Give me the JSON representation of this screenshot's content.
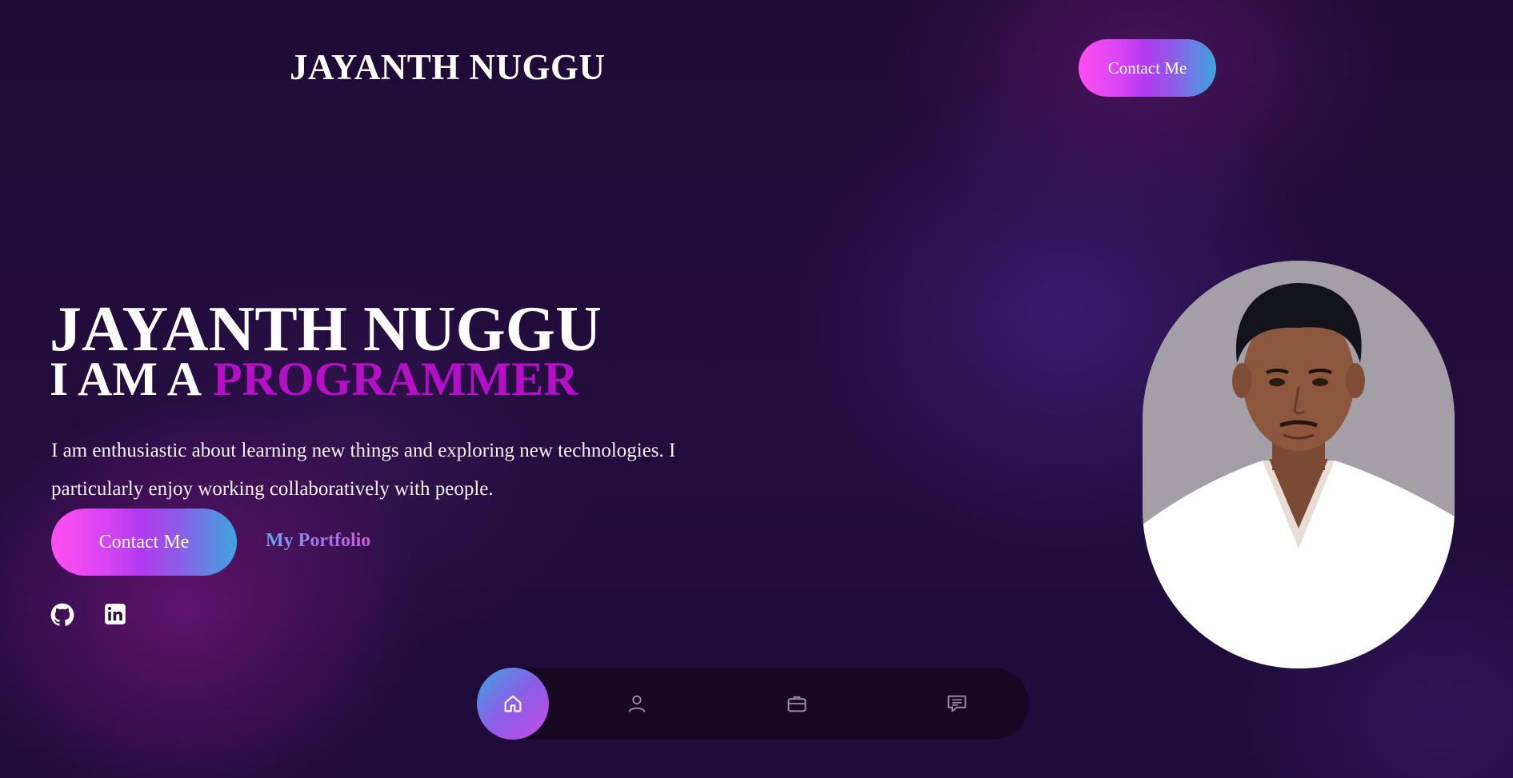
{
  "header": {
    "brand": "JAYANTH NUGGU",
    "contact_label": "Contact Me"
  },
  "hero": {
    "name": "JAYANTH NUGGU",
    "role_prefix": "I AM A",
    "role_highlight": "PROGRAMMER",
    "description": "I am enthusiastic about learning new things and exploring new technologies. I particularly enjoy working collaboratively with people.",
    "contact_label": "Contact Me",
    "portfolio_label": "My Portfolio"
  },
  "social": [
    {
      "icon": "github-icon"
    },
    {
      "icon": "linkedin-icon"
    }
  ],
  "bottom_nav": {
    "items": [
      {
        "icon": "home-icon",
        "active": true
      },
      {
        "icon": "user-icon",
        "active": false
      },
      {
        "icon": "briefcase-icon",
        "active": false
      },
      {
        "icon": "message-icon",
        "active": false
      }
    ]
  },
  "colors": {
    "background": "#1e0b36",
    "accent": "#b50fc8",
    "gradient_start": "#ff4ff2",
    "gradient_mid": "#b23af0",
    "gradient_end": "#3ea5e0"
  }
}
